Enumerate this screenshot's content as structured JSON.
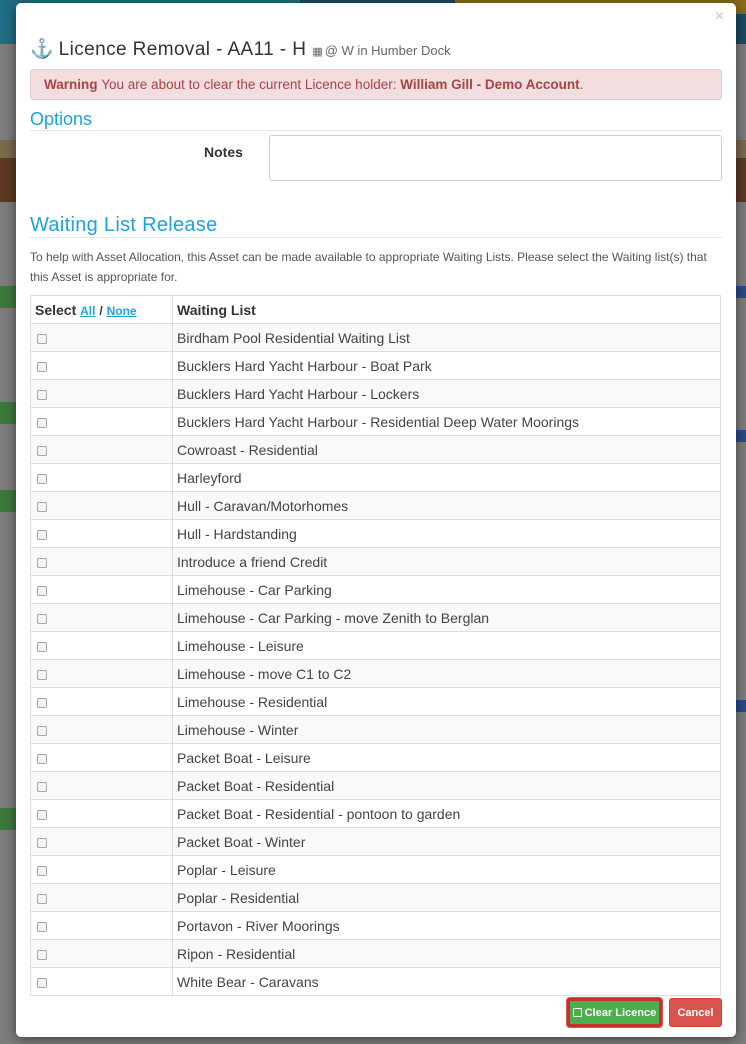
{
  "modal": {
    "close_label": "×",
    "title": "Licence Removal - AA11 - H",
    "location": "@ W in Humber Dock"
  },
  "warning": {
    "label": "Warning",
    "message": "You are about to clear the current Licence holder:",
    "holder": "William Gill - Demo Account",
    "suffix": "."
  },
  "options": {
    "title": "Options",
    "notes_label": "Notes",
    "notes_value": ""
  },
  "waiting_list": {
    "title": "Waiting List Release",
    "description": "To help with Asset Allocation, this Asset can be made available to appropriate Waiting Lists. Please select the Waiting list(s) that this Asset is appropriate for.",
    "select_header": "Select",
    "all_link": "All",
    "separator": "/",
    "none_link": "None",
    "list_header": "Waiting List",
    "items": [
      "Birdham Pool Residential Waiting List",
      "Bucklers Hard Yacht Harbour - Boat Park",
      "Bucklers Hard Yacht Harbour - Lockers",
      "Bucklers Hard Yacht Harbour - Residential Deep Water Moorings",
      "Cowroast - Residential",
      "Harleyford",
      "Hull - Caravan/Motorhomes",
      "Hull - Hardstanding",
      "Introduce a friend Credit",
      "Limehouse - Car Parking",
      "Limehouse - Car Parking - move Zenith to Berglan",
      "Limehouse - Leisure",
      "Limehouse - move C1 to C2",
      "Limehouse - Residential",
      "Limehouse - Winter",
      "Packet Boat - Leisure",
      "Packet Boat - Residential",
      "Packet Boat - Residential - pontoon to garden",
      "Packet Boat - Winter",
      "Poplar - Leisure",
      "Poplar - Residential",
      "Portavon - River Moorings",
      "Ripon - Residential",
      "White Bear - Caravans"
    ]
  },
  "buttons": {
    "clear_label": "Clear Licence",
    "cancel_label": "Cancel"
  },
  "colors": {
    "accent": "#1ea3da",
    "warning_bg": "#f2dede",
    "warning_text": "#a94442",
    "success": "#4cae4c",
    "danger": "#d9534f"
  }
}
